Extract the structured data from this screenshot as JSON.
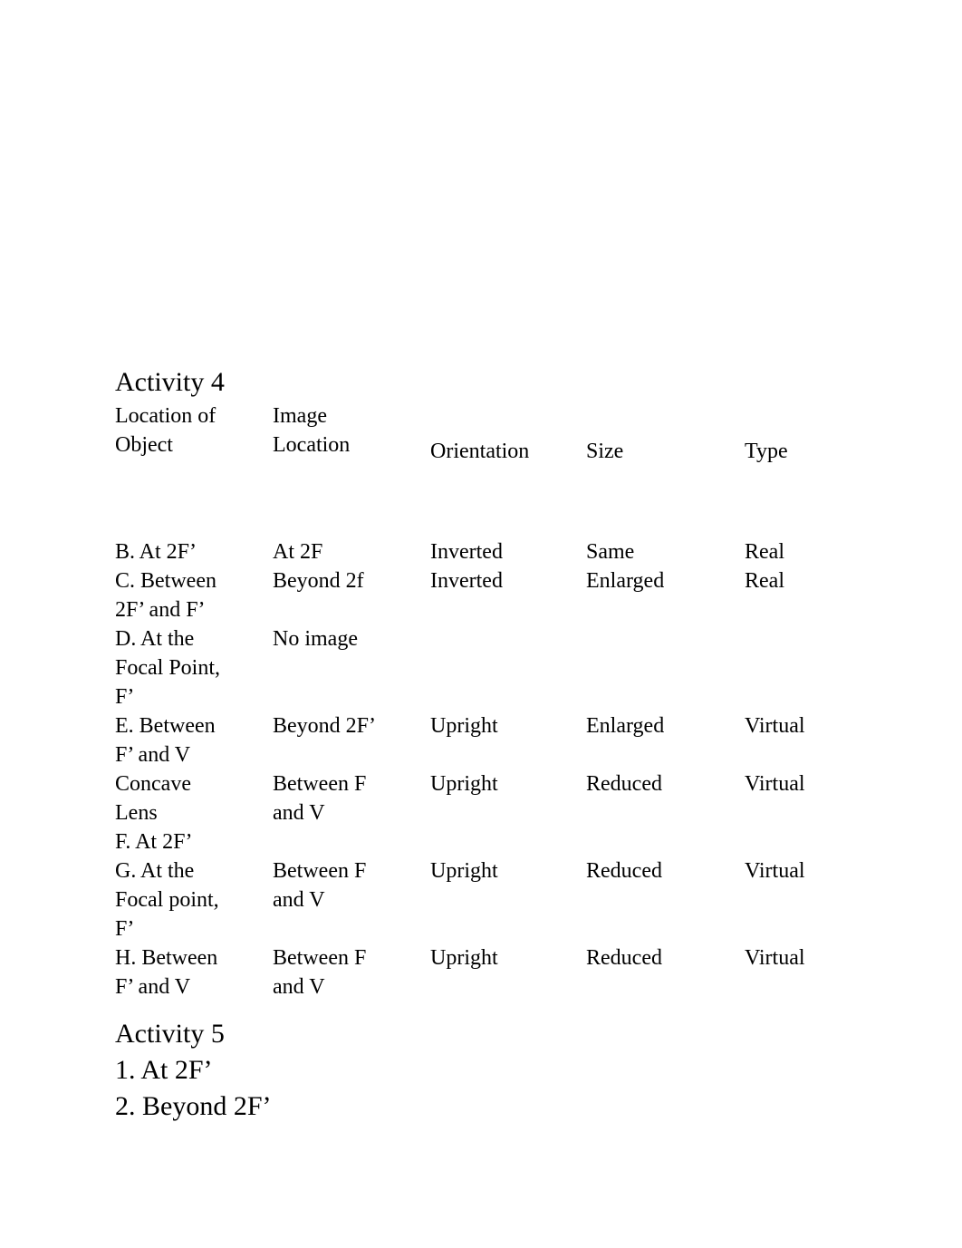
{
  "document": {
    "background_color": "#ffffff",
    "text_color": "#000000"
  },
  "activity4": {
    "heading": "Activity 4",
    "table": {
      "headers": {
        "object_location_line1": "Location of",
        "object_location_line2": "Object",
        "image_group_line1": "Image",
        "image_group_line2": "Location",
        "orientation": "Orientation",
        "size": "Size",
        "type": "Type"
      },
      "rows": [
        {
          "object_location": [
            "B. At 2F’"
          ],
          "image_location": [
            "At 2F"
          ],
          "orientation": "Inverted",
          "size": "Same",
          "type": "Real"
        },
        {
          "object_location": [
            "C. Between",
            "2F’ and F’"
          ],
          "image_location": [
            "Beyond 2f"
          ],
          "orientation": "Inverted",
          "size": "Enlarged",
          "type": "Real"
        },
        {
          "object_location": [
            "D. At the",
            "Focal Point,",
            "F’"
          ],
          "image_location": [
            "No image"
          ],
          "orientation": "",
          "size": "",
          "type": ""
        },
        {
          "object_location": [
            "E. Between",
            "F’ and V"
          ],
          "image_location": [
            "Beyond 2F’"
          ],
          "orientation": "Upright",
          "size": "Enlarged",
          "type": "Virtual"
        },
        {
          "object_location": [
            "Concave",
            "Lens",
            "F. At 2F’"
          ],
          "image_location": [
            "Between F",
            "and V"
          ],
          "orientation": "Upright",
          "size": "Reduced",
          "type": "Virtual"
        },
        {
          "object_location": [
            "G. At the",
            "Focal point,",
            "F’"
          ],
          "image_location": [
            "Between F",
            "and V"
          ],
          "orientation": "Upright",
          "size": "Reduced",
          "type": "Virtual"
        },
        {
          "object_location": [
            "H. Between",
            "F’ and V"
          ],
          "image_location": [
            "Between F",
            "and V"
          ],
          "orientation": "Upright",
          "size": "Reduced",
          "type": "Virtual"
        }
      ]
    }
  },
  "activity5": {
    "heading": "Activity 5",
    "items": [
      "1. At 2F’",
      "2. Beyond 2F’"
    ]
  }
}
